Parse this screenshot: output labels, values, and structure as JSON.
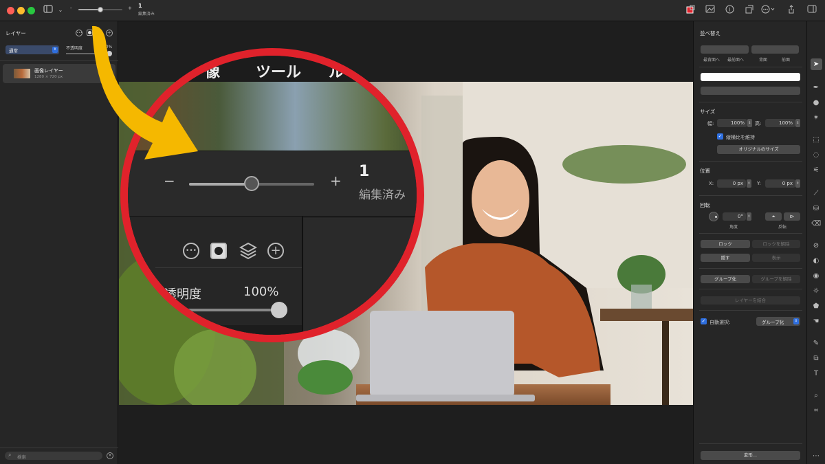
{
  "titlebar": {
    "zoom_minus": "-",
    "zoom_plus": "+",
    "zoom_value": 0.5,
    "edit_count": "1",
    "edit_status": "編集済み"
  },
  "layers_panel": {
    "title": "レイヤー",
    "blend_mode": "通常",
    "opacity_label": "不透明度",
    "opacity_value": "100%",
    "layers": [
      {
        "name": "画像レイヤー",
        "size": "1280 × 720 px"
      }
    ],
    "search_placeholder": "検索"
  },
  "zoom_overlay": {
    "menu_text": "ツール",
    "menu_text_left": "像",
    "menu_text_right": "ル",
    "minus": "−",
    "plus": "+",
    "count": "1",
    "status": "編集済み",
    "opacity_label": "透明度",
    "opacity_value": "100%"
  },
  "arrange_panel": {
    "title": "並べ替え",
    "order_buttons": [
      "最背面へ",
      "最前面へ",
      "背面",
      "前面"
    ],
    "size_title": "サイズ",
    "width_label": "幅:",
    "width_value": "100%",
    "height_label": "高:",
    "height_value": "100%",
    "keep_ratio_label": "縦横比を維持",
    "keep_ratio_checked": true,
    "original_size_button": "オリジナルのサイズ",
    "position_title": "位置",
    "x_label": "X:",
    "x_value": "0 px",
    "y_label": "Y:",
    "y_value": "0 px",
    "rotation_title": "回転",
    "angle_value": "0°",
    "angle_label": "角度",
    "flip_label": "反転",
    "lock_button": "ロック",
    "unlock_button": "ロックを解除",
    "hide_button": "隠す",
    "show_button": "表示",
    "group_button": "グループ化",
    "ungroup_button": "グループを解除",
    "merge_button": "レイヤーを結合",
    "auto_select_label": "自動選択:",
    "auto_select_checked": true,
    "auto_select_value": "グループ化",
    "transform_button": "変形..."
  },
  "colors": {
    "accent": "#2f6fdf",
    "highlight_ring": "#e0222b",
    "arrow": "#f5b800"
  }
}
